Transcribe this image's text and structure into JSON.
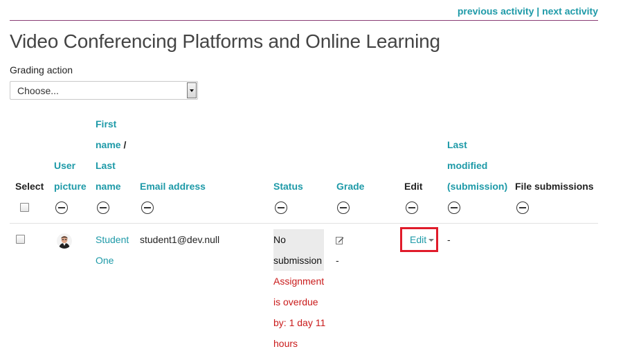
{
  "nav": {
    "previous": "previous activity",
    "separator": "|",
    "next": "next activity"
  },
  "page_title": "Video Conferencing Platforms and Online Learning",
  "grading": {
    "label": "Grading action",
    "selected": "Choose..."
  },
  "table": {
    "headers": {
      "select": "Select",
      "user_picture_1": "User",
      "user_picture_2": "picture",
      "first_name_1": "First",
      "first_name_2": "name",
      "slash": "/",
      "last_name_1": "Last",
      "last_name_2": "name",
      "email": "Email address",
      "status": "Status",
      "grade": "Grade",
      "edit": "Edit",
      "last_modified_1": "Last",
      "last_modified_2": "modified",
      "last_modified_3": "(submission)",
      "file_submissions": "File submissions"
    },
    "row": {
      "first_name": "Student",
      "last_name": "One",
      "email": "student1@dev.null",
      "status_1": "No",
      "status_2": "submission",
      "overdue_1": "Assignment",
      "overdue_2": "is overdue",
      "overdue_3": "by: 1 day 11",
      "overdue_4": "hours",
      "grade_value": "-",
      "edit_label": "Edit",
      "last_modified": "-"
    }
  },
  "icons": {
    "hide_column": "minus-circle-icon",
    "grade": "pencil-square-icon",
    "edit_caret": "caret-down-icon"
  },
  "colors": {
    "link": "#1e9aa8",
    "overdue": "#c91a1a",
    "highlight": "#e01b2a",
    "nav_rule": "#8a3d75"
  }
}
